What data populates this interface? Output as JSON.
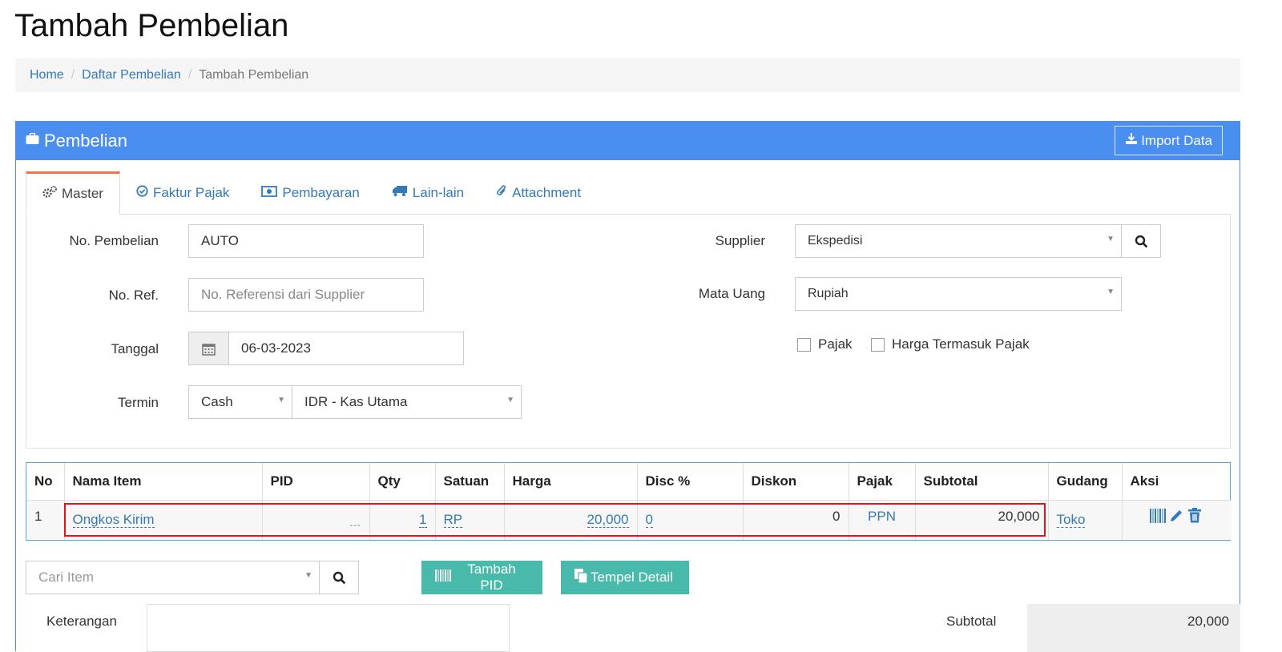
{
  "page": {
    "title": "Tambah Pembelian"
  },
  "breadcrumb": {
    "home": "Home",
    "list": "Daftar Pembelian",
    "current": "Tambah Pembelian",
    "separator": "/"
  },
  "panel": {
    "title": "Pembelian",
    "import_label": "Import Data",
    "header_color": "#4a8ff0"
  },
  "tabs": [
    {
      "label": "Master",
      "icon": "gears-icon"
    },
    {
      "label": "Faktur Pajak",
      "icon": "check-circle-icon"
    },
    {
      "label": "Pembayaran",
      "icon": "money-icon"
    },
    {
      "label": "Lain-lain",
      "icon": "truck-icon"
    },
    {
      "label": "Attachment",
      "icon": "paperclip-icon"
    }
  ],
  "form": {
    "no_pembelian": {
      "label": "No. Pembelian",
      "value": "AUTO"
    },
    "no_ref": {
      "label": "No. Ref.",
      "placeholder": "No. Referensi dari Supplier"
    },
    "tanggal": {
      "label": "Tanggal",
      "value": "06-03-2023"
    },
    "termin": {
      "label": "Termin",
      "value": "Cash",
      "account": "IDR - Kas Utama"
    },
    "supplier": {
      "label": "Supplier",
      "value": "Ekspedisi"
    },
    "mata_uang": {
      "label": "Mata Uang",
      "value": "Rupiah"
    },
    "pajak": {
      "label": "Pajak"
    },
    "harga_termasuk_pajak": {
      "label": "Harga Termasuk Pajak"
    }
  },
  "items_table": {
    "headers": [
      "No",
      "Nama Item",
      "PID",
      "Qty",
      "Satuan",
      "Harga",
      "Disc %",
      "Diskon",
      "Pajak",
      "Subtotal",
      "Gudang",
      "Aksi"
    ],
    "rows": [
      {
        "no": "1",
        "nama_item": "Ongkos Kirim",
        "pid": "---",
        "qty": "1",
        "satuan": "RP",
        "harga": "20,000",
        "disc": "0",
        "diskon": "0",
        "pajak": "PPN",
        "subtotal": "20,000",
        "gudang": "Toko"
      }
    ]
  },
  "bottom": {
    "cari_item_placeholder": "Cari Item",
    "tambah_pid_label": "Tambah PID",
    "tempel_detail_label": "Tempel Detail",
    "keterangan_label": "Keterangan",
    "subtotal_label": "Subtotal",
    "subtotal_value": "20,000"
  },
  "colors": {
    "accent": "#4a8ff0",
    "teal": "#49b9ab",
    "highlight": "#e0141e",
    "link": "#337ab7"
  }
}
